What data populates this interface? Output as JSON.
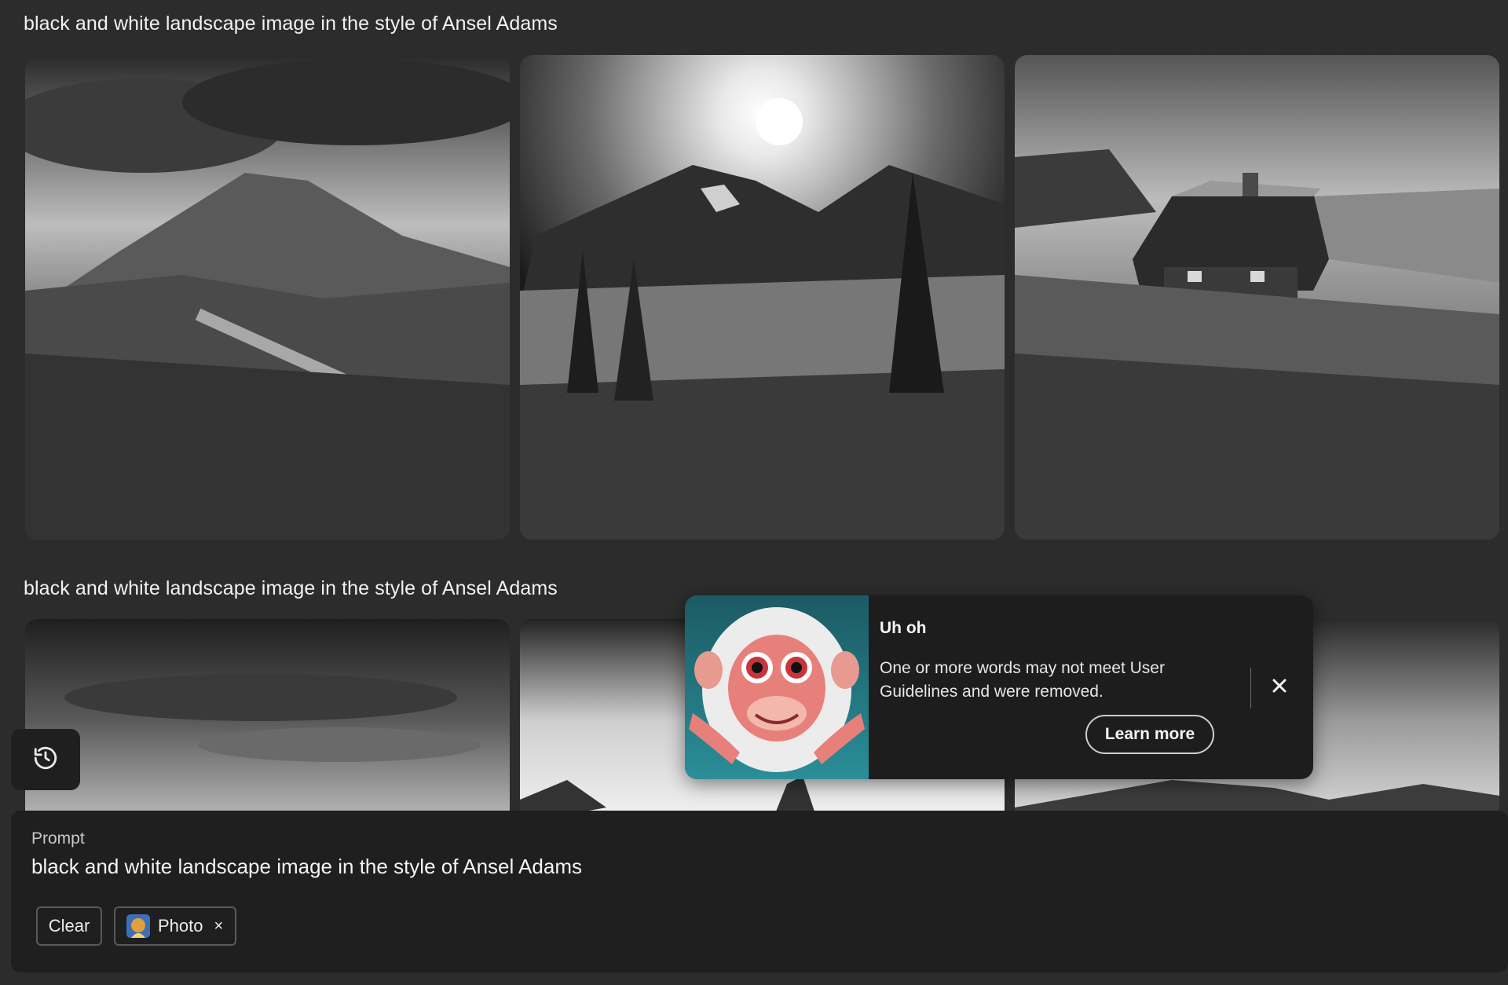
{
  "gallery": {
    "rows": [
      {
        "title": "black and white landscape image in the style of Ansel Adams"
      },
      {
        "title": "black and white landscape image in the style of Ansel Adams"
      }
    ]
  },
  "history": {
    "icon": "history-icon"
  },
  "prompt_panel": {
    "label": "Prompt",
    "text": "black and white landscape image in the style of Ansel Adams",
    "clear_label": "Clear",
    "style_chip_label": "Photo",
    "style_chip_remove": "×"
  },
  "toast": {
    "title": "Uh oh",
    "message": "One or more words may not meet User Guidelines and were removed.",
    "button_label": "Learn more",
    "close_icon": "close-icon"
  },
  "colors": {
    "background": "#2c2c2c",
    "panel": "#1f1f1f",
    "toast_bg": "#1d1d1d"
  }
}
